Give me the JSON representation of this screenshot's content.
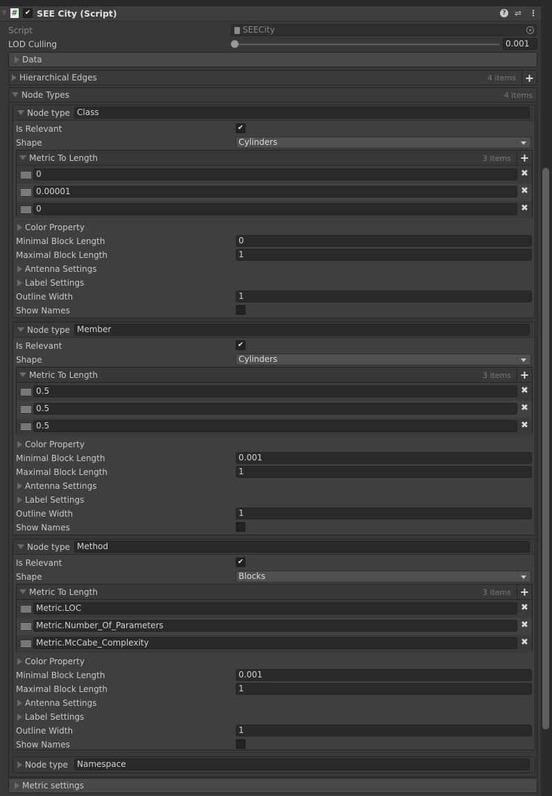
{
  "component": {
    "title": "SEE City (Script)",
    "enabled": true,
    "icons": [
      "help-icon",
      "preset-icon",
      "more-menu-icon"
    ]
  },
  "script": {
    "label": "Script",
    "value": "SEECity"
  },
  "lod_culling": {
    "label": "LOD Culling",
    "value": "0.001",
    "slider_fraction": 0.001
  },
  "sections": {
    "data": "Data",
    "hierarchical_edges": {
      "label": "Hierarchical Edges",
      "count": "4 items"
    },
    "node_types": {
      "label": "Node Types",
      "count": "4 items"
    },
    "metric_settings": "Metric settings"
  },
  "labels": {
    "node_type": "Node type",
    "is_relevant": "Is Relevant",
    "shape": "Shape",
    "metric_to_length": "Metric To Length",
    "color_property": "Color Property",
    "minimal_block_length": "Minimal Block Length",
    "maximal_block_length": "Maximal Block Length",
    "antenna_settings": "Antenna Settings",
    "label_settings": "Label Settings",
    "outline_width": "Outline Width",
    "show_names": "Show Names"
  },
  "node_types": [
    {
      "name": "Class",
      "is_relevant": true,
      "shape": "Cylinders",
      "metric_count": "3 items",
      "metrics": [
        "0",
        "0.00001",
        "0"
      ],
      "min_block": "0",
      "max_block": "1",
      "outline_width": "1",
      "show_names": false
    },
    {
      "name": "Member",
      "is_relevant": true,
      "shape": "Cylinders",
      "metric_count": "3 items",
      "metrics": [
        "0.5",
        "0.5",
        "0.5"
      ],
      "min_block": "0.001",
      "max_block": "1",
      "outline_width": "1",
      "show_names": false
    },
    {
      "name": "Method",
      "is_relevant": true,
      "shape": "Blocks",
      "metric_count": "3 items",
      "metrics": [
        "Metric.LOC",
        "Metric.Number_Of_Parameters",
        "Metric.McCabe_Complexity"
      ],
      "min_block": "0.001",
      "max_block": "1",
      "outline_width": "1",
      "show_names": false
    },
    {
      "name": "Namespace"
    }
  ]
}
